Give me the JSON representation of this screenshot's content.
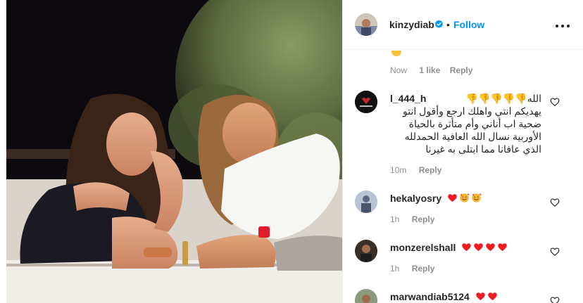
{
  "post": {
    "username": "kinzydiab",
    "follow_label": "Follow",
    "dot": "•"
  },
  "colors": {
    "follow_blue": "#0095f6",
    "verified_blue": "#0095f6",
    "muted_gray": "#8e8e8e",
    "text_dark": "#262626",
    "heart_red": "#ed1c24"
  },
  "previous_comment": {
    "time": "Now",
    "likes": "1 like",
    "reply": "Reply"
  },
  "comments": [
    {
      "username": "l_444_h",
      "lines": [
        "الله👎👎👎👎👎",
        "يهديكم انتي واهلك ارجع وأقول انتو",
        "ضحية اب أناني وأم متأثرة بالحياة",
        "الأوربية نسال الله العافية الحمدلله",
        "الذي عافانا مما ابتلى به غيرنا"
      ],
      "time": "10m",
      "reply": "Reply"
    },
    {
      "username": "hekalyosry",
      "emojis": [
        "red-heart",
        "smiling-face-with-hearts",
        "smiling-face-with-hearts"
      ],
      "time": "1h",
      "reply": "Reply"
    },
    {
      "username": "monzerelshall",
      "emojis": [
        "red-heart",
        "red-heart",
        "red-heart",
        "red-heart"
      ],
      "time": "1h",
      "reply": "Reply"
    },
    {
      "username": "marwandiab5124",
      "emojis": [
        "red-heart",
        "red-heart"
      ]
    }
  ],
  "icons": {
    "more": "more-options-icon",
    "like": "heart-outline-icon",
    "verified": "verified-badge-icon"
  }
}
